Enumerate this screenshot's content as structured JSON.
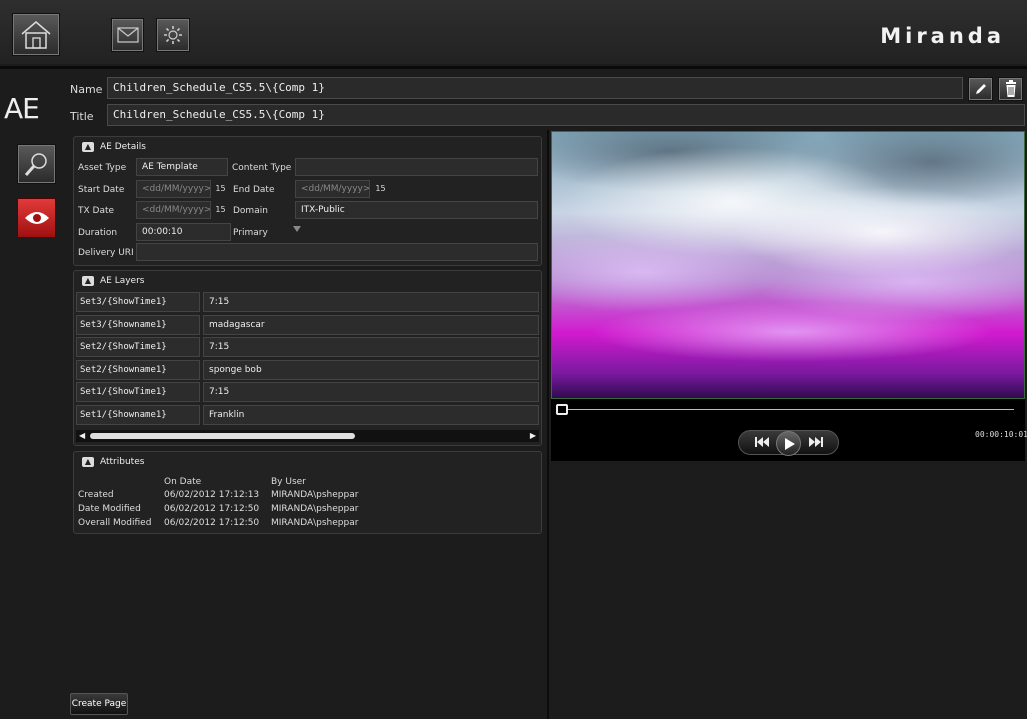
{
  "header": {
    "logo": "Miranda"
  },
  "asset": {
    "badge": "AE",
    "name_label": "Name",
    "name_value": "Children_Schedule_CS5.5\\{Comp 1}",
    "title_label": "Title",
    "title_value": "Children_Schedule_CS5.5\\{Comp 1}"
  },
  "details": {
    "header": "AE Details",
    "asset_type_label": "Asset Type",
    "asset_type_value": "AE Template",
    "content_type_label": "Content Type",
    "content_type_value": "",
    "start_date_label": "Start Date",
    "start_date_placeholder": "<dd/MM/yyyy>",
    "end_date_label": "End Date",
    "end_date_placeholder": "<dd/MM/yyyy>",
    "tx_date_label": "TX Date",
    "tx_date_placeholder": "<dd/MM/yyyy>",
    "domain_label": "Domain",
    "domain_value": "ITX-Public",
    "duration_label": "Duration",
    "duration_value": "00:00:10",
    "primary_label": "Primary",
    "delivery_label": "Delivery URI",
    "delivery_value": "",
    "calendar_day": "15"
  },
  "layers": {
    "header": "AE Layers",
    "rows": [
      {
        "key": "Set3/{ShowTime1}",
        "value": "7:15"
      },
      {
        "key": "Set3/{Showname1}",
        "value": "madagascar"
      },
      {
        "key": "Set2/{ShowTime1}",
        "value": "7:15"
      },
      {
        "key": "Set2/{Showname1}",
        "value": "sponge bob"
      },
      {
        "key": "Set1/{ShowTime1}",
        "value": "7:15"
      },
      {
        "key": "Set1/{Showname1}",
        "value": "Franklin"
      }
    ]
  },
  "attributes": {
    "header": "Attributes",
    "col_date": "On Date",
    "col_user": "By User",
    "rows": [
      {
        "label": "Created",
        "date": "06/02/2012 17:12:13",
        "user": "MIRANDA\\psheppar"
      },
      {
        "label": "Date Modified",
        "date": "06/02/2012 17:12:50",
        "user": "MIRANDA\\psheppar"
      },
      {
        "label": "Overall Modified",
        "date": "06/02/2012 17:12:50",
        "user": "MIRANDA\\psheppar"
      }
    ]
  },
  "player": {
    "timecode": "00:00:10:01",
    "progress": 0
  },
  "footer": {
    "create_page": "Create Page"
  }
}
